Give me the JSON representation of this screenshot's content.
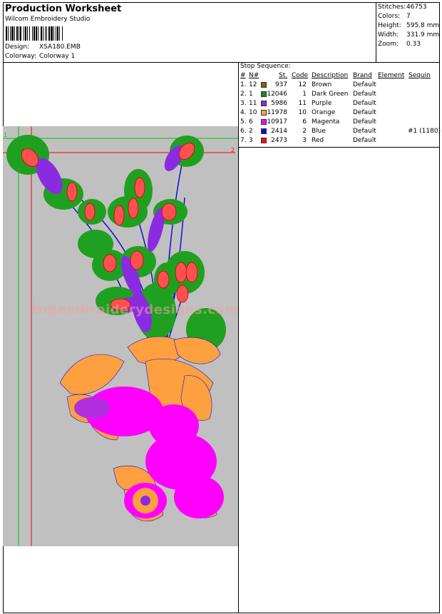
{
  "header": {
    "title": "Production Worksheet",
    "software": "Wilcom Embroidery Studio",
    "design_label": "Design:",
    "design_value": "XSA180.EMB",
    "colorway_label": "Colorway:",
    "colorway_value": "Colorway 1"
  },
  "stats": [
    {
      "label": "Stitches:",
      "value": "46753"
    },
    {
      "label": "Colors:",
      "value": "7"
    },
    {
      "label": "Height:",
      "value": "595.8 mm"
    },
    {
      "label": "Width:",
      "value": "331.9 mm"
    },
    {
      "label": "Zoom:",
      "value": "0.33"
    }
  ],
  "stop_sequence": {
    "title": "Stop Sequence:",
    "headers": [
      "#",
      "N#",
      "St.",
      "Code",
      "Description",
      "Brand",
      "Element",
      "Sequin"
    ],
    "rows": [
      {
        "num": "1.",
        "n": "12",
        "st": "937",
        "code": "12",
        "desc": "Brown",
        "brand": "Default",
        "element": "",
        "sequin": "",
        "color": "#8b5a2b"
      },
      {
        "num": "2.",
        "n": "1",
        "st": "12046",
        "code": "1",
        "desc": "Dark Green",
        "brand": "Default",
        "element": "",
        "sequin": "",
        "color": "#1a8a1a"
      },
      {
        "num": "3.",
        "n": "11",
        "st": "5986",
        "code": "11",
        "desc": "Purple",
        "brand": "Default",
        "element": "",
        "sequin": "",
        "color": "#8a2be2"
      },
      {
        "num": "4.",
        "n": "10",
        "st": "11978",
        "code": "10",
        "desc": "Orange",
        "brand": "Default",
        "element": "",
        "sequin": "",
        "color": "#ffa040"
      },
      {
        "num": "5.",
        "n": "6",
        "st": "10917",
        "code": "6",
        "desc": "Magenta",
        "brand": "Default",
        "element": "",
        "sequin": "",
        "color": "#ff00ff"
      },
      {
        "num": "6.",
        "n": "2",
        "st": "2414",
        "code": "2",
        "desc": "Blue",
        "brand": "Default",
        "element": "",
        "sequin": "#1 (1180)",
        "color": "#1010d0"
      },
      {
        "num": "7.",
        "n": "3",
        "st": "2473",
        "code": "3",
        "desc": "Red",
        "brand": "Default",
        "element": "",
        "sequin": "",
        "color": "#ff1010"
      }
    ]
  },
  "design_canvas": {
    "guide_labels": [
      "1",
      "2"
    ],
    "watermark": "topembroiderydesigns.com",
    "colors": {
      "background": "#c0c0c0",
      "green_guide": "#00cc00",
      "red_guide": "#ff0000"
    }
  }
}
